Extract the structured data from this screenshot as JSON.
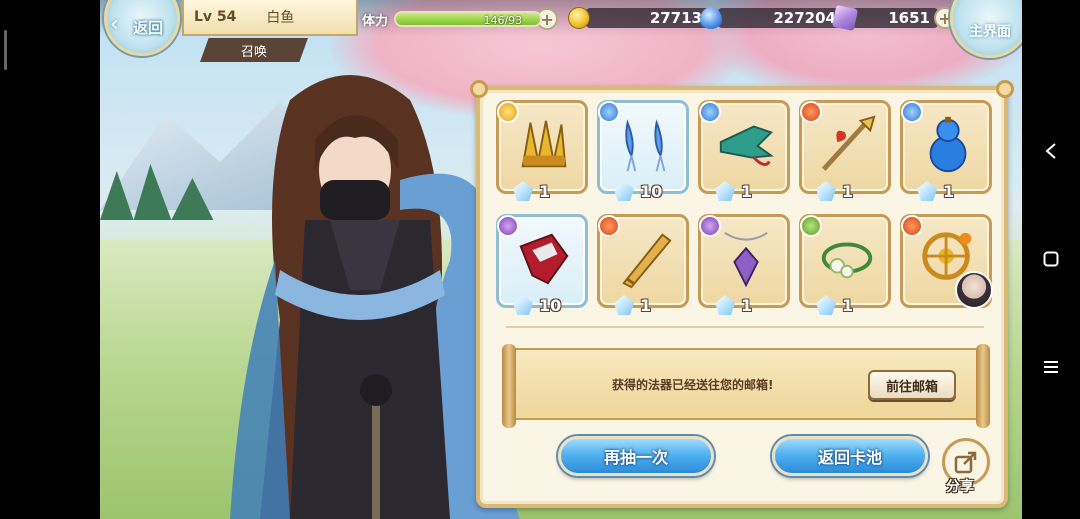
{
  "header": {
    "back_label": "返回",
    "level": "Lv 54",
    "player_name": "白鱼",
    "section_tag": "召唤",
    "stamina_label": "体力",
    "stamina_value": "146/93",
    "stamina_fill": 1.0,
    "gold": "27713",
    "water": "227204",
    "gems": "1651",
    "home_label": "主界面"
  },
  "rewards": [
    {
      "count": "1",
      "element": "gold",
      "icon": "golden-claw-icon"
    },
    {
      "count": "10",
      "element": "water",
      "icon": "blue-earrings-icon"
    },
    {
      "count": "1",
      "element": "water",
      "icon": "jade-claw-gauntlet-icon"
    },
    {
      "count": "1",
      "element": "fire",
      "icon": "red-tasseled-spear-icon"
    },
    {
      "count": "1",
      "element": "water",
      "icon": "blue-gourd-icon"
    },
    {
      "count": "10",
      "element": "dark",
      "icon": "crimson-cloth-icon"
    },
    {
      "count": "1",
      "element": "fire",
      "icon": "golden-scabbard-icon"
    },
    {
      "count": "1",
      "element": "dark",
      "icon": "crystal-pendant-icon"
    },
    {
      "count": "1",
      "element": "wood",
      "icon": "flower-bracelet-icon"
    },
    {
      "count": "",
      "element": "fire",
      "icon": "golden-wheel-icon"
    }
  ],
  "notice": {
    "message": "获得的法器已经送往您的邮箱!",
    "mailbox_button": "前往邮箱"
  },
  "actions": {
    "draw_again": "再抽一次",
    "back_to_pool": "返回卡池",
    "share": "分享"
  },
  "colors": {
    "panel_bg": "#fbf5e6",
    "panel_border": "#d8b978",
    "button_blue": "#52b2f0"
  }
}
